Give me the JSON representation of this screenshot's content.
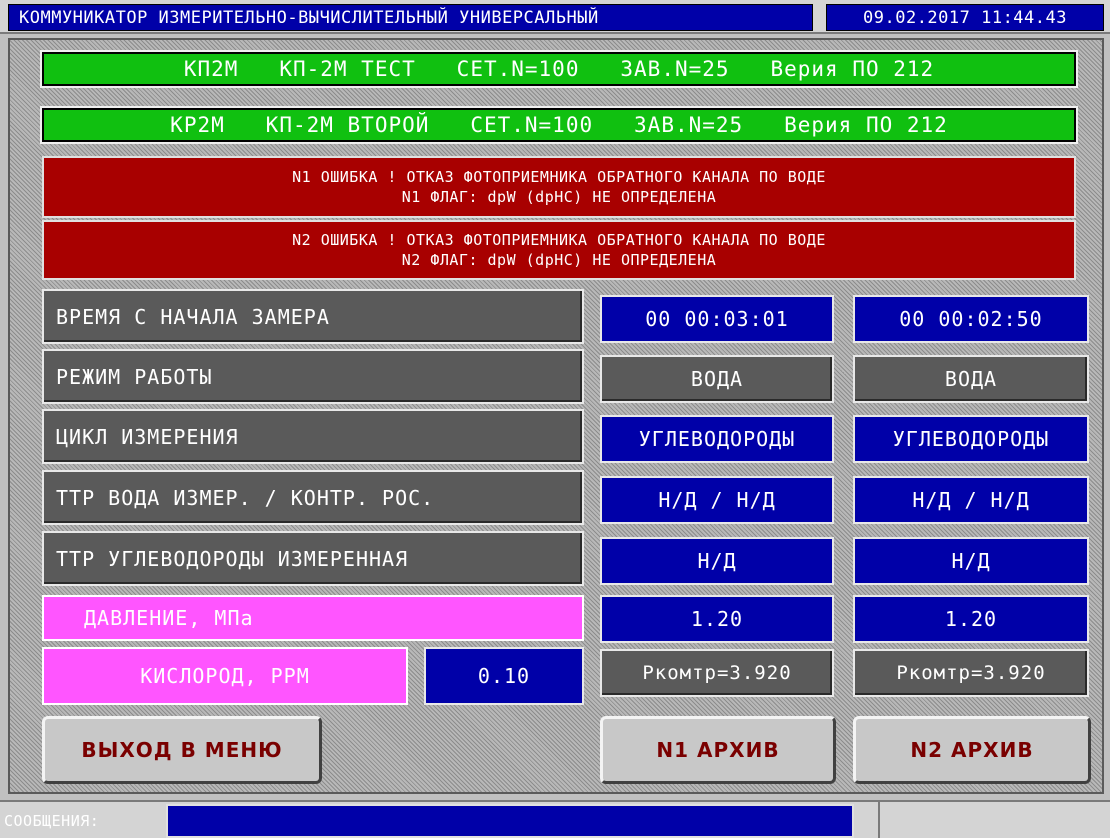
{
  "header": {
    "title": "КОММУНИКАТОР ИЗМЕРИТЕЛЬНО-ВЫЧИСЛИТЕЛЬНЫЙ УНИВЕРСАЛЬНЫЙ",
    "datetime": "09.02.2017 11:44.43"
  },
  "devices": [
    {
      "line": "КП2М   КП-2М ТЕСТ   СЕТ.N=100   ЗАВ.N=25   Верия ПО 212"
    },
    {
      "line": "КР2М   КП-2М ВТОРОЙ   СЕТ.N=100   ЗАВ.N=25   Верия ПО 212"
    }
  ],
  "errors": [
    {
      "line1": "N1 ОШИБКА ! ОТКАЗ ФОТОПРИЕМНИКА ОБРАТНОГО КАНАЛА ПО ВОДЕ",
      "line2": "N1 ФЛАГ: dpW (dpHC) НЕ ОПРЕДЕЛЕНА"
    },
    {
      "line1": "N2 ОШИБКА ! ОТКАЗ ФОТОПРИЕМНИКА ОБРАТНОГО КАНАЛА ПО ВОДЕ",
      "line2": "N2 ФЛАГ: dpW (dpHC) НЕ ОПРЕДЕЛЕНА"
    }
  ],
  "rows": [
    {
      "label": "ВРЕМЯ С НАЧАЛА ЗАМЕРА",
      "n1": "00 00:03:01",
      "n2": "00 00:02:50"
    },
    {
      "label": "РЕЖИМ РАБОТЫ",
      "n1": "ВОДА",
      "n2": "ВОДА"
    },
    {
      "label": "ЦИКЛ ИЗМЕРЕНИЯ",
      "n1": "УГЛЕВОДОРОДЫ",
      "n2": "УГЛЕВОДОРОДЫ"
    },
    {
      "label": "ТТР ВОДА ИЗМЕР. / КОНТР. РОС.",
      "n1": "Н/Д / Н/Д",
      "n2": "Н/Д / Н/Д"
    },
    {
      "label": "ТТР УГЛЕВОДОРОДЫ ИЗМЕРЕННАЯ",
      "n1": "Н/Д",
      "n2": "Н/Д"
    },
    {
      "label": "ДАВЛЕНИЕ, МПа",
      "n1": "1.20",
      "n2": "1.20"
    }
  ],
  "oxygen": {
    "label": "КИСЛОРОД, PPM",
    "value": "0.10",
    "n1": "Ркомтр=3.920",
    "n2": "Ркомтр=3.920"
  },
  "buttons": {
    "menu": "ВЫХОД В МЕНЮ",
    "archive1": "N1 АРХИВ",
    "archive2": "N2 АРХИВ"
  },
  "status": {
    "messages_label": "СООБЩЕНИЯ:"
  },
  "colors": {
    "green": "#10c010",
    "red": "#a80000",
    "blue": "#0000a8",
    "grey": "#5a5a5a",
    "magenta": "#ff55ff"
  }
}
